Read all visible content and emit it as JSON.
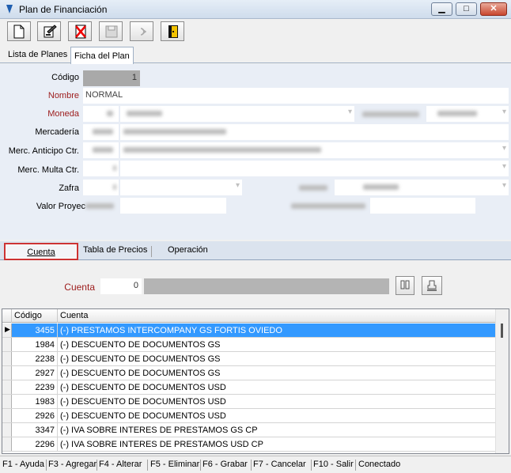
{
  "window": {
    "title": "Plan de Financiación"
  },
  "main_tabs": [
    {
      "label": "Lista de Planes"
    },
    {
      "label": "Ficha del Plan"
    }
  ],
  "form": {
    "codigo_label": "Código",
    "codigo_value": "1",
    "nombre_label": "Nombre",
    "nombre_value": "NORMAL",
    "moneda_label": "Moneda",
    "mercaderia_label": "Mercadería",
    "merc_anticipo_label": "Merc. Anticipo Ctr.",
    "merc_multa_label": "Merc. Multa Ctr.",
    "zafra_label": "Zafra",
    "valor_proyec_label": "Valor Proyec"
  },
  "sub_tabs": [
    {
      "label": "Cuenta"
    },
    {
      "label": "Tabla de Precios"
    },
    {
      "label": "Operación"
    }
  ],
  "cuenta": {
    "label": "Cuenta",
    "value": "0"
  },
  "grid": {
    "columns": [
      "Código",
      "Cuenta"
    ],
    "rows": [
      {
        "code": "3455",
        "name": "(-) PRESTAMOS INTERCOMPANY GS FORTIS OVIEDO"
      },
      {
        "code": "1984",
        "name": "(-) DESCUENTO DE DOCUMENTOS GS"
      },
      {
        "code": "2238",
        "name": "(-) DESCUENTO DE DOCUMENTOS GS"
      },
      {
        "code": "2927",
        "name": "(-) DESCUENTO DE DOCUMENTOS GS"
      },
      {
        "code": "2239",
        "name": "(-) DESCUENTO DE DOCUMENTOS USD"
      },
      {
        "code": "1983",
        "name": "(-) DESCUENTO DE DOCUMENTOS USD"
      },
      {
        "code": "2926",
        "name": "(-) DESCUENTO DE DOCUMENTOS USD"
      },
      {
        "code": "3347",
        "name": "(-) IVA SOBRE INTERES DE PRESTAMOS GS CP"
      },
      {
        "code": "2296",
        "name": "(-) IVA SOBRE INTERES DE PRESTAMOS USD CP"
      }
    ]
  },
  "statusbar": {
    "f1": "F1 - Ayuda",
    "f3": "F3 - Agregar",
    "f4": "F4 - Alterar",
    "f5": "F5 - Eliminar",
    "f6": "F6 - Grabar",
    "f7": "F7 - Cancelar",
    "f10": "F10 - Salir",
    "status": "Conectado"
  },
  "colors": {
    "required_label": "#9c1b1b",
    "selection": "#3399ff",
    "form_bg": "#e9eef6"
  }
}
